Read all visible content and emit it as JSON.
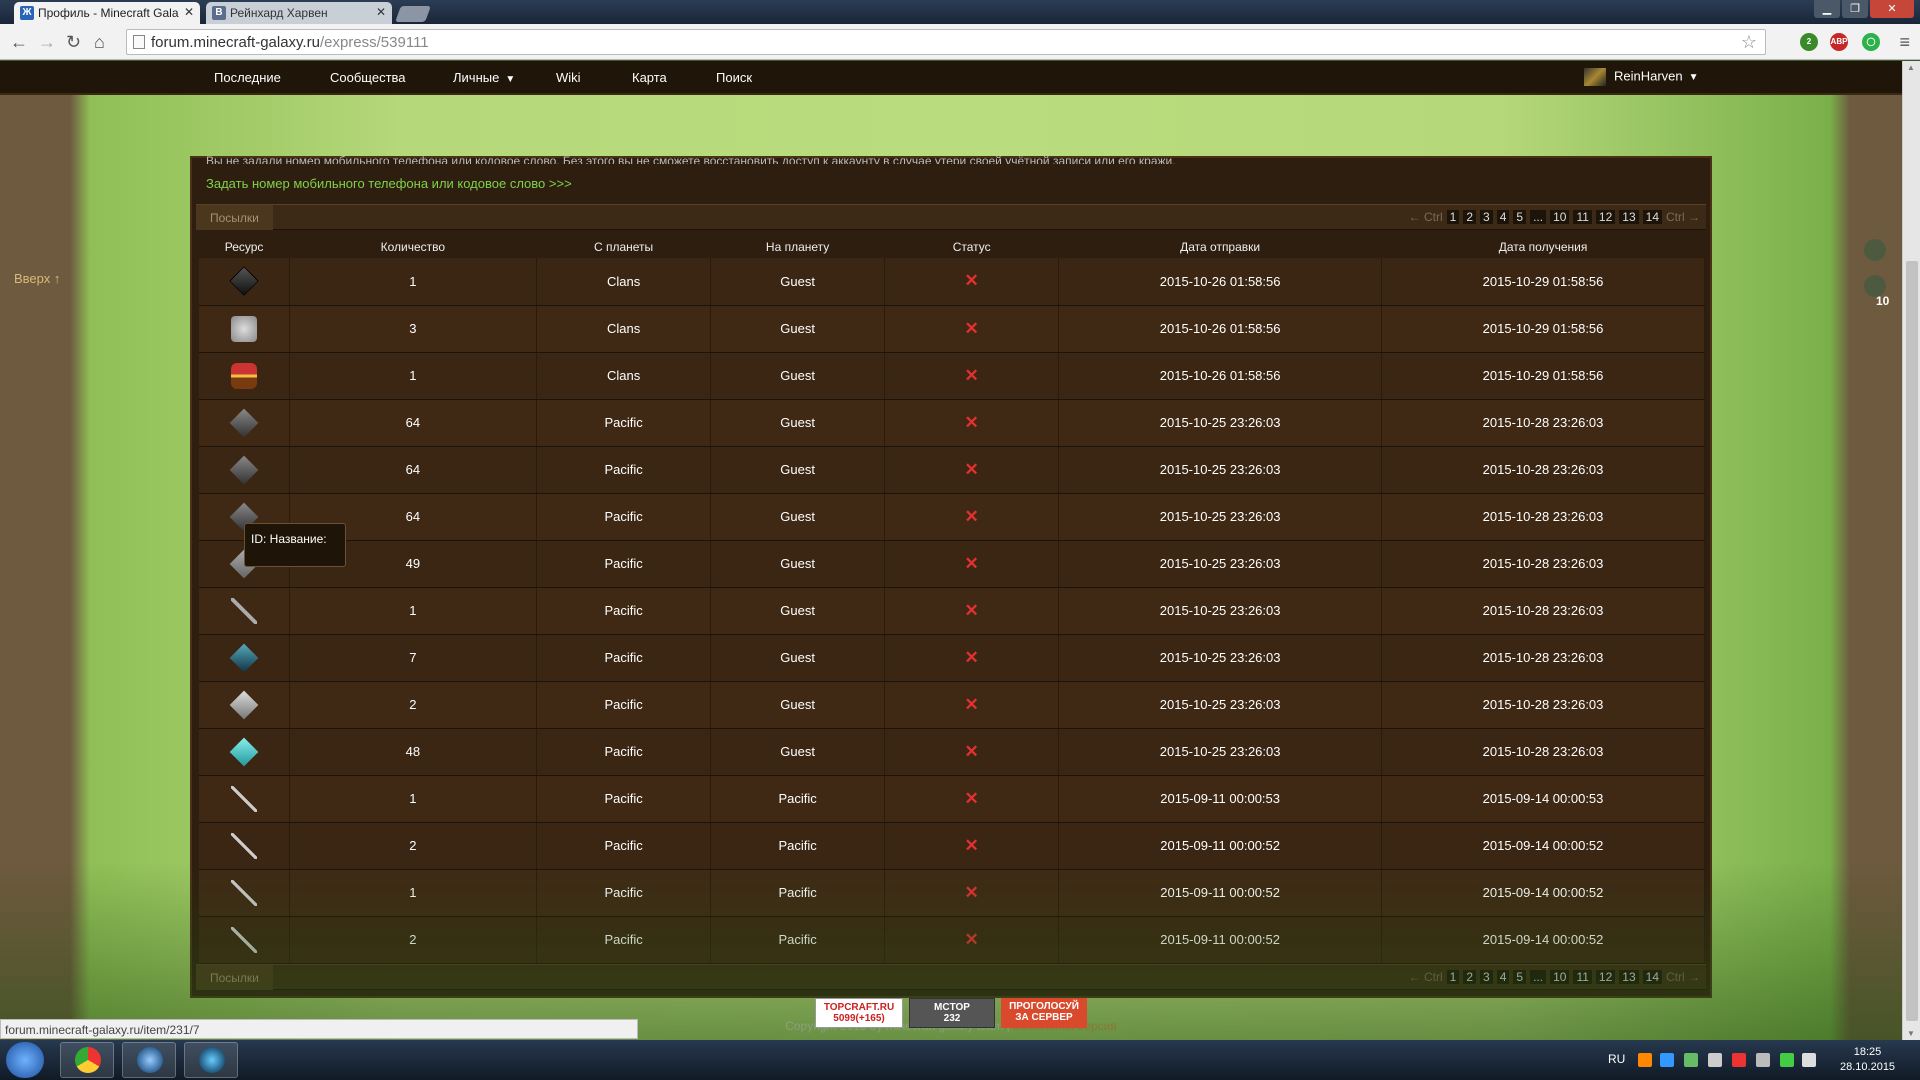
{
  "browser": {
    "tabs": [
      {
        "label": "Профиль - Minecraft Gala"
      },
      {
        "label": "Рейнхард Харвен"
      }
    ],
    "url": "forum.minecraft-galaxy.ru",
    "url_path": "/express/539111",
    "window_buttons": [
      "▁",
      "❐",
      "✕"
    ]
  },
  "nav": {
    "items": [
      "Последние",
      "Сообщества",
      "Личные",
      "Wiki",
      "Карта",
      "Поиск"
    ],
    "user": "ReinHarven"
  },
  "side": {
    "up_label": "Вверх ↑",
    "count": "10"
  },
  "notice": {
    "text": "Вы не задали номер мобильного телефона или кодовое слово. Без этого вы не сможете восстановить доступ к аккаунту в случае утери своей учётной записи или его кражи.",
    "link": "Задать номер мобильного телефона или кодовое слово >>>"
  },
  "section": {
    "label": "Посылки",
    "pager": {
      "prev": "← Ctrl",
      "next": "Ctrl →",
      "pages": [
        "1",
        "2",
        "3",
        "4",
        "5",
        "...",
        "10",
        "11",
        "12",
        "13",
        "14"
      ]
    }
  },
  "table": {
    "headers": [
      "Ресурс",
      "Количество",
      "С планеты",
      "На планету",
      "Статус",
      "Дата отправки",
      "Дата получения"
    ],
    "rows": [
      {
        "icon": "dark-block-icon",
        "qty": "1",
        "from": "Clans",
        "to": "Guest",
        "status": "✕",
        "sent": "2015-10-26 01:58:56",
        "recv": "2015-10-29 01:58:56"
      },
      {
        "icon": "robot-item-icon",
        "qty": "3",
        "from": "Clans",
        "to": "Guest",
        "status": "✕",
        "sent": "2015-10-26 01:58:56",
        "recv": "2015-10-29 01:58:56"
      },
      {
        "icon": "chest-icon",
        "qty": "1",
        "from": "Clans",
        "to": "Guest",
        "status": "✕",
        "sent": "2015-10-26 01:58:56",
        "recv": "2015-10-29 01:58:56"
      },
      {
        "icon": "stone-block-icon",
        "qty": "64",
        "from": "Pacific",
        "to": "Guest",
        "status": "✕",
        "sent": "2015-10-25 23:26:03",
        "recv": "2015-10-28 23:26:03"
      },
      {
        "icon": "stone-block-icon",
        "qty": "64",
        "from": "Pacific",
        "to": "Guest",
        "status": "✕",
        "sent": "2015-10-25 23:26:03",
        "recv": "2015-10-28 23:26:03"
      },
      {
        "icon": "stone-block-icon",
        "qty": "64",
        "from": "Pacific",
        "to": "Guest",
        "status": "✕",
        "sent": "2015-10-25 23:26:03",
        "recv": "2015-10-28 23:26:03"
      },
      {
        "icon": "gray-block-icon",
        "qty": "49",
        "from": "Pacific",
        "to": "Guest",
        "status": "✕",
        "sent": "2015-10-25 23:26:03",
        "recv": "2015-10-28 23:26:03"
      },
      {
        "icon": "tool-icon",
        "qty": "1",
        "from": "Pacific",
        "to": "Guest",
        "status": "✕",
        "sent": "2015-10-25 23:26:03",
        "recv": "2015-10-28 23:26:03"
      },
      {
        "icon": "blue-block-icon",
        "qty": "7",
        "from": "Pacific",
        "to": "Guest",
        "status": "✕",
        "sent": "2015-10-25 23:26:03",
        "recv": "2015-10-28 23:26:03"
      },
      {
        "icon": "machine-block-icon",
        "qty": "2",
        "from": "Pacific",
        "to": "Guest",
        "status": "✕",
        "sent": "2015-10-25 23:26:03",
        "recv": "2015-10-28 23:26:03"
      },
      {
        "icon": "diamond-block-icon",
        "qty": "48",
        "from": "Pacific",
        "to": "Guest",
        "status": "✕",
        "sent": "2015-10-25 23:26:03",
        "recv": "2015-10-28 23:26:03"
      },
      {
        "icon": "rod-icon",
        "qty": "1",
        "from": "Pacific",
        "to": "Pacific",
        "status": "✕",
        "sent": "2015-09-11 00:00:53",
        "recv": "2015-09-14 00:00:53"
      },
      {
        "icon": "rod-icon",
        "qty": "2",
        "from": "Pacific",
        "to": "Pacific",
        "status": "✕",
        "sent": "2015-09-11 00:00:52",
        "recv": "2015-09-14 00:00:52"
      },
      {
        "icon": "rod-icon",
        "qty": "1",
        "from": "Pacific",
        "to": "Pacific",
        "status": "✕",
        "sent": "2015-09-11 00:00:52",
        "recv": "2015-09-14 00:00:52"
      },
      {
        "icon": "rod-icon",
        "qty": "2",
        "from": "Pacific",
        "to": "Pacific",
        "status": "✕",
        "sent": "2015-09-11 00:00:52",
        "recv": "2015-09-14 00:00:52"
      }
    ]
  },
  "tooltip": "ID: Название:",
  "footer": {
    "copyright": "Copyright 2015 by minecraft galaxy team |",
    "mobile": "мобильная версия"
  },
  "badges": {
    "topcraft_title": "TOPCRAFT.RU",
    "topcraft_value": "5099(+165)",
    "mctop_title": "MCTOP",
    "mctop_value": "232",
    "vote_title": "ПРОГОЛОСУЙ",
    "vote_sub": "ЗА СЕРВЕР"
  },
  "status_url": "forum.minecraft-galaxy.ru/item/231/7",
  "taskbar": {
    "lang": "RU",
    "time": "18:25",
    "date": "28.10.2015"
  },
  "colors": {
    "accent_link": "#7fd24a",
    "status_x": "#e53030",
    "panel_bg": "#2e1e0f"
  }
}
